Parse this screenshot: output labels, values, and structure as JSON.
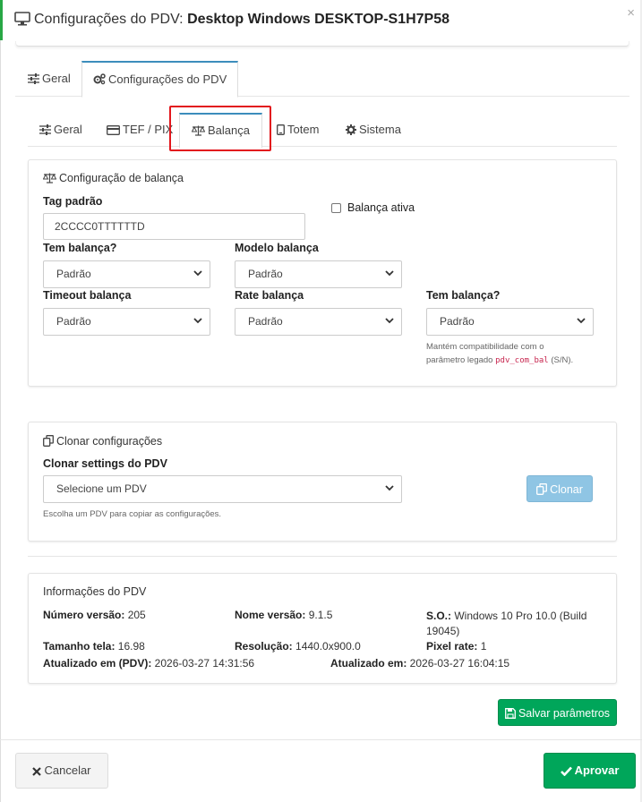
{
  "modal": {
    "title_prefix": "Configurações do PDV: ",
    "title_device": "Desktop Windows DESKTOP-S1H7P58",
    "close": "×"
  },
  "tabs_top": [
    {
      "label": "Geral",
      "icon": "sliders-icon"
    },
    {
      "label": "Configurações do PDV",
      "icon": "cogs-icon",
      "active": true
    }
  ],
  "tabs_inner": [
    {
      "label": "Geral",
      "icon": "sliders-icon"
    },
    {
      "label": "TEF / PIX",
      "icon": "credit-card-icon"
    },
    {
      "label": "Balança",
      "icon": "balance-scale-icon",
      "active": true
    },
    {
      "label": "Totem",
      "icon": "tablet-icon"
    },
    {
      "label": "Sistema",
      "icon": "gear-icon"
    }
  ],
  "balanca": {
    "title": "Configuração de balança",
    "tag_label": "Tag padrão",
    "tag_value": "2CCCC0TTTTTTD",
    "ativa_label": "Balança ativa",
    "tem_label": "Tem balança?",
    "tem_value": "Padrão",
    "modelo_label": "Modelo balança",
    "modelo_value": "Padrão",
    "timeout_label": "Timeout balança",
    "timeout_value": "Padrão",
    "rate_label": "Rate balança",
    "rate_value": "Padrão",
    "tem2_label": "Tem balança?",
    "tem2_value": "Padrão",
    "help_line1": "Mantém compatibilidade com o",
    "help_line2_pre": "parâmetro legado ",
    "help_code": "pdv_com_bal",
    "help_line2_post": " (S/N)."
  },
  "clonar": {
    "title": "Clonar configurações",
    "label": "Clonar settings do PDV",
    "select_value": "Selecione um PDV",
    "help": "Escolha um PDV para copiar as configurações.",
    "button": "Clonar"
  },
  "info": {
    "title": "Informações do PDV",
    "numero_label": "Número versão:",
    "numero_value": " 205",
    "nome_label": "Nome versão:",
    "nome_value": " 9.1.5",
    "so_label": "S.O.:",
    "so_value_line1": " Windows 10 Pro 10.0 (Build",
    "so_value_line2": "19045)",
    "tamanho_label": "Tamanho tela:",
    "tamanho_value": " 16.98",
    "resolucao_label": "Resolução:",
    "resolucao_value": " 1440.0x900.0",
    "pixel_label": "Pixel rate:",
    "pixel_value": " 1",
    "atual_pdv_label": "Atualizado em (PDV):",
    "atual_pdv_value": " 2026-03-27 14:31:56",
    "atual_label": "Atualizado em:",
    "atual_value": " 2026-03-27 16:04:15"
  },
  "buttons": {
    "salvar": "Salvar parâmetros",
    "cancelar": "Cancelar",
    "aprovar": "Aprovar"
  },
  "colors": {
    "primary_tab": "#3c8dbc",
    "success": "#00a65a",
    "highlight": "#e2171d"
  }
}
